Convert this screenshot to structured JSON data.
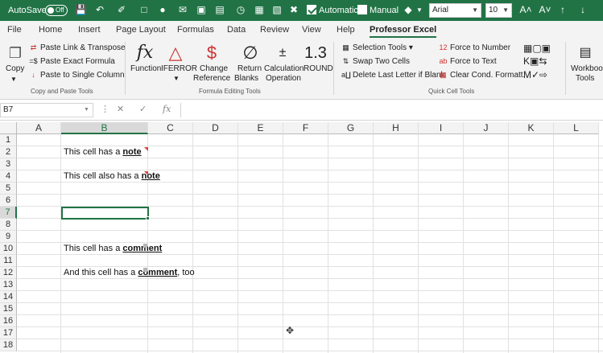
{
  "titlebar": {
    "autosave_label": "AutoSave",
    "autosave_state": "Off",
    "automatic_label": "Automatic",
    "manual_label": "Manual",
    "font_name": "Arial",
    "font_size": "10",
    "grow_font_icon": "A˄",
    "shrink_font_icon": "A˅"
  },
  "tabs": [
    "File",
    "Home",
    "Insert",
    "Page Layout",
    "Formulas",
    "Data",
    "Review",
    "View",
    "Help",
    "Professor Excel"
  ],
  "active_tab": "Professor Excel",
  "ribbon": {
    "copy": {
      "label": "Copy"
    },
    "paste_link": "Paste Link & Transpose",
    "paste_exact": "Paste Exact Formula",
    "paste_single": "Paste to Single Column",
    "group1_label": "Copy and Paste Tools",
    "function_label": "Function",
    "iferror_label": "IFERROR",
    "change_ref_label_1": "Change",
    "change_ref_label_2": "Reference",
    "return_blanks_1": "Return",
    "return_blanks_2": "Blanks",
    "calc_op_1": "Calculation",
    "calc_op_2": "Operation",
    "round_label": "ROUND",
    "group2_label": "Formula Editing Tools",
    "selection_tools": "Selection Tools",
    "swap_cells": "Swap Two Cells",
    "delete_last_letter": "Delete Last Letter if Blank",
    "force_number": "Force to Number",
    "force_text": "Force to Text",
    "clear_cond": "Clear Cond. Formatt.",
    "group3_label": "Quick Cell Tools",
    "workbook_tools_1": "Workbook",
    "workbook_tools_2": "Tools",
    "fx_glyph": "fx",
    "round_glyph": "1.3"
  },
  "formula_bar": {
    "name_box": "B7",
    "fx": "fx",
    "content": ""
  },
  "sheet": {
    "columns": [
      "A",
      "B",
      "C",
      "D",
      "E",
      "F",
      "G",
      "H",
      "I",
      "J",
      "K",
      "L"
    ],
    "rows": [
      "1",
      "2",
      "3",
      "4",
      "5",
      "6",
      "7",
      "8",
      "9",
      "10",
      "11",
      "12",
      "13",
      "14",
      "15",
      "16",
      "17",
      "18"
    ],
    "selected_cell": "B7",
    "cells": {
      "b2_pre": "This cell has a ",
      "b2_em": "note",
      "b4_pre": "This cell also has a ",
      "b4_em": "note",
      "b10_pre": "This cell has a ",
      "b10_em": "comment",
      "b12_pre": "And this cell has a ",
      "b12_em": "comment",
      "b12_post": ", too"
    }
  },
  "colors": {
    "accent": "#217346"
  }
}
